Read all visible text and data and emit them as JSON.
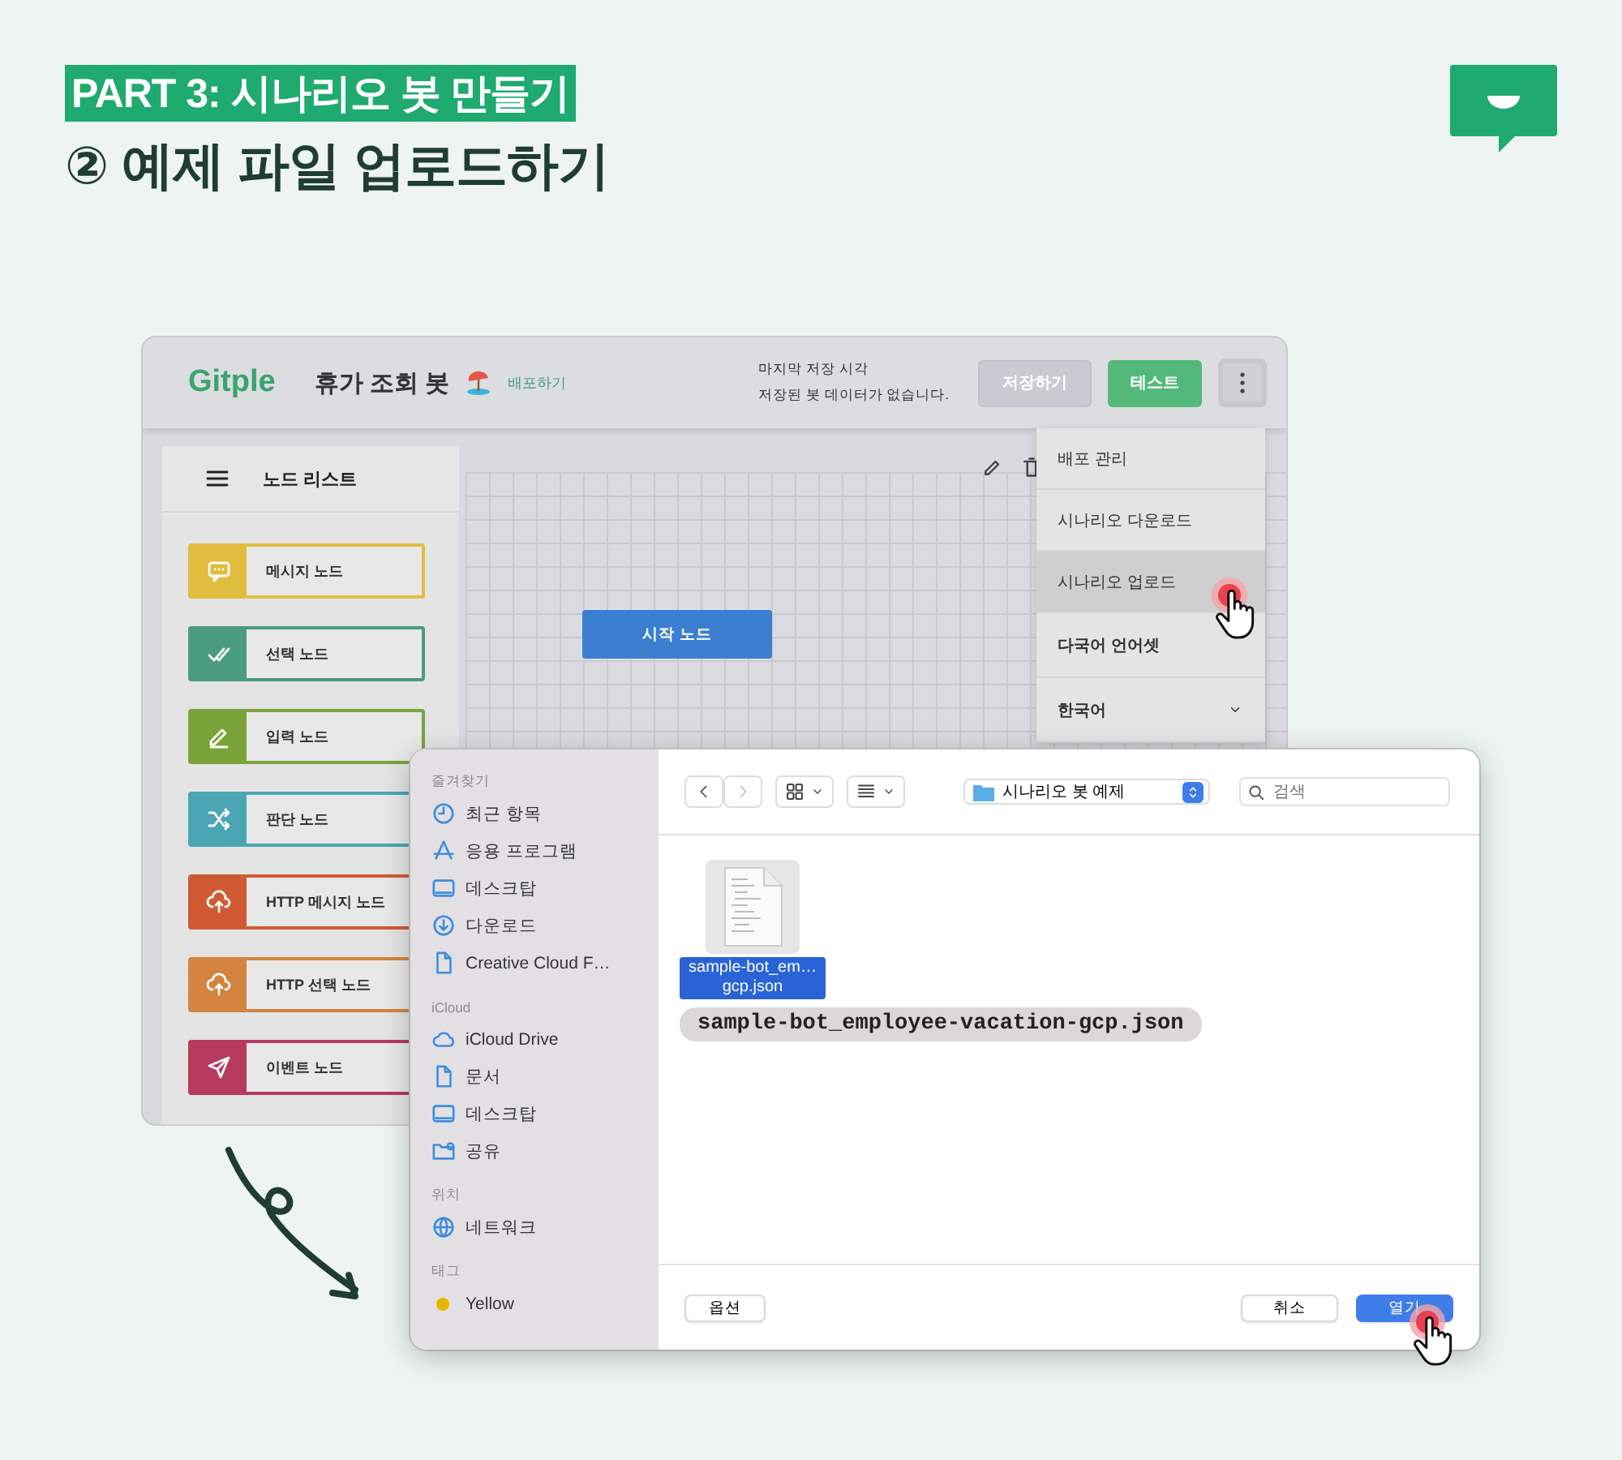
{
  "header": {
    "badge": "PART 3: 시나리오 봇 만들기",
    "title": "② 예제 파일 업로드하기"
  },
  "app": {
    "logo": "Gitple",
    "bot_name": "휴가 조회 봇",
    "deploy_link": "배포하기",
    "save_status": [
      "마지막 저장 시각",
      "저장된 봇 데이터가 없습니다."
    ],
    "buttons": [
      {
        "label": "저장하기",
        "disabled": true
      },
      {
        "label": "테스트",
        "disabled": false
      }
    ],
    "node_list": {
      "title": "노드 리스트",
      "nodes": [
        {
          "label": "메시지 노드",
          "color": "#e0bd3e"
        },
        {
          "label": "선택 노드",
          "color": "#4a9c7f"
        },
        {
          "label": "입력 노드",
          "color": "#7aa33a"
        },
        {
          "label": "판단 노드",
          "color": "#4aa6b5"
        },
        {
          "label": "HTTP 메시지 노드",
          "color": "#d05b33"
        },
        {
          "label": "HTTP 선택 노드",
          "color": "#d4843e"
        },
        {
          "label": "이벤트 노드",
          "color": "#b83a5e"
        }
      ]
    },
    "canvas": {
      "start_node": "시작 노드"
    },
    "menu": [
      {
        "label": "배포 관리",
        "kind": "item",
        "selected": false
      },
      {
        "label": "시나리오 다운로드",
        "kind": "item",
        "selected": false
      },
      {
        "label": "시나리오 업로드",
        "kind": "item",
        "selected": true
      },
      {
        "label": "다국어 언어셋",
        "kind": "heading",
        "selected": false
      },
      {
        "label": "한국어",
        "kind": "select",
        "selected": false
      }
    ]
  },
  "dialog": {
    "sections": [
      {
        "title": "즐겨찾기",
        "items": [
          {
            "label": "최근 항목",
            "kind": "place"
          },
          {
            "label": "응용 프로그램",
            "kind": "place"
          },
          {
            "label": "데스크탑",
            "kind": "place"
          },
          {
            "label": "다운로드",
            "kind": "place"
          },
          {
            "label": "Creative Cloud F…",
            "kind": "place"
          }
        ]
      },
      {
        "title": "iCloud",
        "items": [
          {
            "label": "iCloud Drive",
            "kind": "place"
          },
          {
            "label": "문서",
            "kind": "place"
          },
          {
            "label": "데스크탑",
            "kind": "place"
          },
          {
            "label": "공유",
            "kind": "place"
          }
        ]
      },
      {
        "title": "위치",
        "items": [
          {
            "label": "네트워크",
            "kind": "place"
          }
        ]
      },
      {
        "title": "태그",
        "items": [
          {
            "label": "Yellow",
            "kind": "tag",
            "color": "#e8b600"
          }
        ]
      }
    ],
    "folder": "시나리오 봇 예제",
    "search": {
      "placeholder": "검색"
    },
    "files": [
      {
        "name": "sample-bot_em…gcp.json",
        "selected": true
      }
    ],
    "callout": "sample-bot_employee-vacation-gcp.json",
    "options_button": "옵션",
    "buttons": [
      {
        "label": "취소",
        "default": false
      },
      {
        "label": "열기",
        "default": true
      }
    ]
  }
}
